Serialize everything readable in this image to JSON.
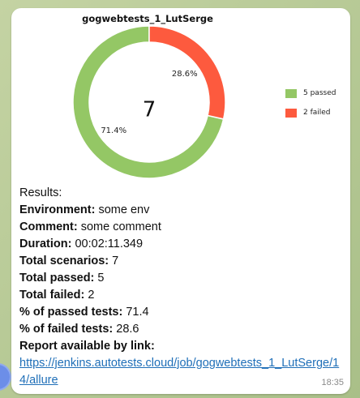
{
  "message": {
    "chart": {
      "title": "gogwebtests_1_LutSerge",
      "center_text": "7",
      "legend": [
        {
          "label": "5 passed",
          "color": "#94c765"
        },
        {
          "label": "2 failed",
          "color": "#fd5a3e"
        }
      ]
    },
    "chart_data": {
      "type": "pie",
      "title": "gogwebtests_1_LutSerge",
      "categories": [
        "passed",
        "failed"
      ],
      "values": [
        5,
        2
      ],
      "percent_labels": [
        "71.4%",
        "28.6%"
      ],
      "colors": [
        "#94c765",
        "#fd5a3e"
      ],
      "center_value": "7",
      "legend_entries": [
        "5 passed",
        "2 failed"
      ],
      "legend_position": "right"
    },
    "results_heading": "Results:",
    "environment_label": "Environment:",
    "environment_value": "some env",
    "comment_label": "Comment:",
    "comment_value": "some comment",
    "duration_label": "Duration:",
    "duration_value": "00:02:11.349",
    "total_scenarios_label": "Total scenarios:",
    "total_scenarios_value": "7",
    "total_passed_label": "Total passed:",
    "total_passed_value": "5",
    "total_failed_label": "Total failed:",
    "total_failed_value": "2",
    "percent_passed_label": "% of passed tests:",
    "percent_passed_value": "71.4",
    "percent_failed_label": "% of failed tests:",
    "percent_failed_value": "28.6",
    "report_label": "Report available by link:",
    "report_link": "https://jenkins.autotests.cloud/job/gogwebtests_1_LutSerge/14/allure",
    "time": "18:35"
  }
}
